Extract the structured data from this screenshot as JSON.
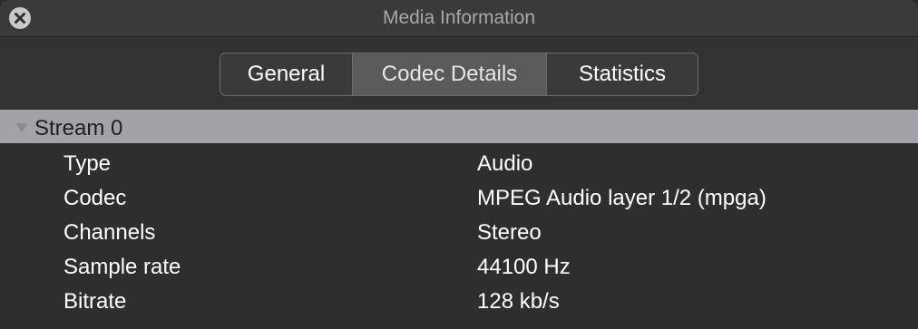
{
  "window": {
    "title": "Media Information"
  },
  "tabs": [
    {
      "label": "General"
    },
    {
      "label": "Codec Details"
    },
    {
      "label": "Statistics"
    }
  ],
  "selected_tab": "Codec Details",
  "stream": {
    "label": "Stream 0",
    "expanded": true,
    "rows": [
      {
        "key": "Type",
        "value": "Audio"
      },
      {
        "key": "Codec",
        "value": "MPEG Audio layer 1/2 (mpga)"
      },
      {
        "key": "Channels",
        "value": "Stereo"
      },
      {
        "key": "Sample rate",
        "value": "44100 Hz"
      },
      {
        "key": "Bitrate",
        "value": "128 kb/s"
      }
    ]
  },
  "colors": {
    "stream_header_bg": "#a2a3a8",
    "selected_tab_bg": "#5a5a5a"
  },
  "icons": {
    "close": "close-x-circle",
    "disclosure": "disclosure-triangle-down"
  }
}
